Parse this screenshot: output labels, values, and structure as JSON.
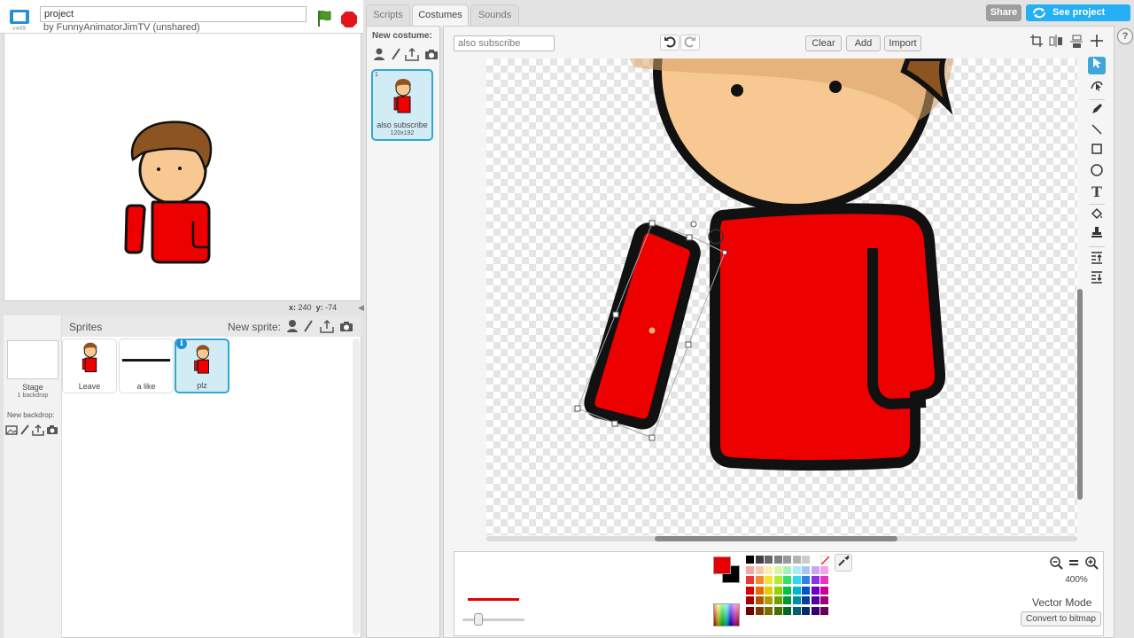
{
  "header": {
    "version": "v449",
    "project_title": "project",
    "author": "by FunnyAnimatorJimTV (unshared)"
  },
  "stage": {
    "mouse_x_label": "x:",
    "mouse_x": "240",
    "mouse_y_label": "y:",
    "mouse_y": "-74"
  },
  "sprites": {
    "title": "Sprites",
    "new_sprite_label": "New sprite:",
    "stage_label": "Stage",
    "stage_backdrops": "1 backdrop",
    "new_backdrop_label": "New backdrop:",
    "items": [
      {
        "name": "Leave"
      },
      {
        "name": "a like"
      },
      {
        "name": "plz"
      }
    ],
    "info_badge": "i"
  },
  "tabs": [
    {
      "label": "Scripts"
    },
    {
      "label": "Costumes"
    },
    {
      "label": "Sounds"
    }
  ],
  "topbar": {
    "share": "Share",
    "see_project": "See project page",
    "help": "?"
  },
  "costumes": {
    "new_costume_label": "New costume:",
    "items": [
      {
        "number": "1",
        "name": "also subscribe",
        "size": "120x192"
      }
    ]
  },
  "editor": {
    "costume_name": "also subscribe",
    "clear": "Clear",
    "add": "Add",
    "import": "Import",
    "zoom_level": "400%",
    "mode": "Vector Mode",
    "convert": "Convert to bitmap",
    "primary_color": "#e70000",
    "secondary_color": "#000000"
  },
  "palette": [
    "#000000",
    "#404040",
    "#666666",
    "#808080",
    "#999999",
    "#b3b3b3",
    "#cccccc",
    "#ffffff",
    "#ffffff",
    "#f4a6a6",
    "#f8c9a6",
    "#fbf1a6",
    "#d9f6a6",
    "#a6f0b9",
    "#a6eef4",
    "#a6c4f4",
    "#c9a6f4",
    "#f4a6e2",
    "#ee3333",
    "#f38a33",
    "#f7e233",
    "#b3ec33",
    "#33e06b",
    "#33d9ea",
    "#3380ea",
    "#8a33ea",
    "#ea33c1",
    "#d90000",
    "#e66a00",
    "#e6cc00",
    "#8fd400",
    "#00c244",
    "#00b8cc",
    "#0055cc",
    "#6a00cc",
    "#cc0099",
    "#a60000",
    "#b35200",
    "#b39e00",
    "#6ea300",
    "#009633",
    "#008f9e",
    "#00419e",
    "#52009e",
    "#9e0077",
    "#730000",
    "#7a3900",
    "#7a6c00",
    "#4b7000",
    "#006623",
    "#00626c",
    "#002d6c",
    "#38006c",
    "#6c0052"
  ]
}
